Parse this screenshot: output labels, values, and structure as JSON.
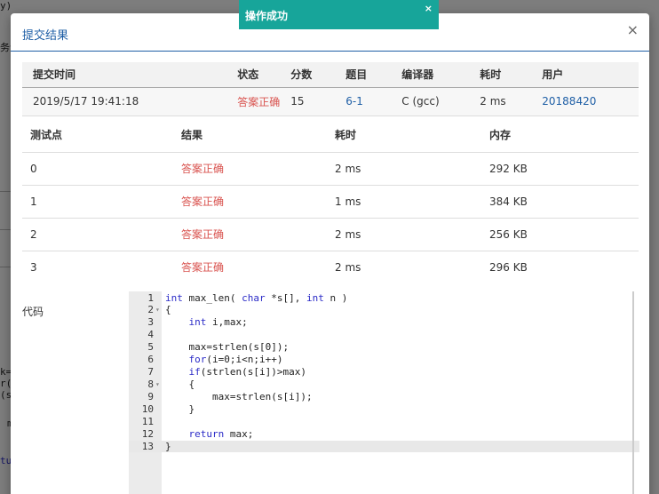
{
  "background_fragments": [
    "y)",
    "务调",
    "k=s",
    "r(i",
    "(st",
    "m",
    "turn"
  ],
  "toast": {
    "text": "操作成功",
    "close": "×"
  },
  "modal": {
    "title": "提交结果",
    "close": "×"
  },
  "summary": {
    "headers": [
      "提交时间",
      "状态",
      "分数",
      "题目",
      "编译器",
      "耗时",
      "用户"
    ],
    "row": {
      "time": "2019/5/17 19:41:18",
      "status": "答案正确",
      "score": "15",
      "problem": "6-1",
      "compiler": "C (gcc)",
      "elapsed": "2 ms",
      "user": "20188420"
    }
  },
  "cases": {
    "headers": [
      "测试点",
      "结果",
      "耗时",
      "内存"
    ],
    "rows": [
      {
        "id": "0",
        "result": "答案正确",
        "time": "2 ms",
        "memory": "292 KB"
      },
      {
        "id": "1",
        "result": "答案正确",
        "time": "1 ms",
        "memory": "384 KB"
      },
      {
        "id": "2",
        "result": "答案正确",
        "time": "2 ms",
        "memory": "256 KB"
      },
      {
        "id": "3",
        "result": "答案正确",
        "time": "2 ms",
        "memory": "296 KB"
      }
    ]
  },
  "code": {
    "label": "代码",
    "line_numbers": [
      "1",
      "2",
      "3",
      "4",
      "5",
      "6",
      "7",
      "8",
      "9",
      "10",
      "11",
      "12",
      "13"
    ],
    "fold_marker": "▾",
    "lines": [
      "int max_len( char *s[], int n )",
      "{",
      "    int i,max;",
      "",
      "    max=strlen(s[0]);",
      "    for(i=0;i<n;i++)",
      "    if(strlen(s[i])>max)",
      "    {",
      "        max=strlen(s[i]);",
      "    }",
      "",
      "    return max;",
      "}"
    ]
  },
  "colors": {
    "accent": "#1f5fa6",
    "success_toast": "#17a59a",
    "accepted": "#d9534f",
    "keyword": "#2b2bc7"
  }
}
